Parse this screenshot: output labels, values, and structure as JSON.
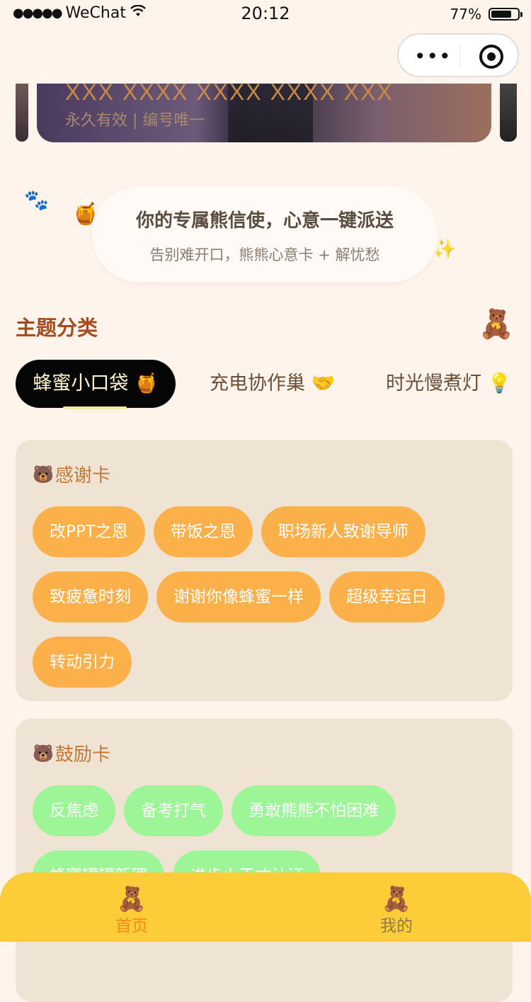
{
  "status_bar": {
    "signal": "●●●●●",
    "carrier": "WeChat",
    "wifi_icon": "wifi-icon",
    "time": "20:12",
    "battery_pct": "77%",
    "battery_level": 0.77
  },
  "capsule": {
    "more": "•••",
    "close_icon": "record-icon"
  },
  "banner": {
    "title": "XXX XXXX XXXX XXXX XXX",
    "subtitle": "永久有效 | 编号唯一"
  },
  "hero": {
    "title": "你的专属熊信使，心意一键派送",
    "subtitle": "告别难开口，熊熊心意卡 + 解忧愁",
    "paw": "🐾",
    "honey": "🍯",
    "sparkle": "✨"
  },
  "section": {
    "title": "主题分类",
    "mascot": "🧸"
  },
  "tabs": [
    {
      "label": "蜂蜜小口袋 🍯",
      "active": true
    },
    {
      "label": "充电协作巢 🤝",
      "active": false
    },
    {
      "label": "时光慢煮灯 💡",
      "active": false
    }
  ],
  "cards": [
    {
      "bear": "🐻",
      "title": "感谢卡",
      "chips": [
        "改PPT之恩",
        "带饭之恩",
        "职场新人致谢导师",
        "致疲惫时刻",
        "谢谢你像蜂蜜一样",
        "超级幸运日",
        "转动引力"
      ]
    },
    {
      "bear": "🐻",
      "title": "鼓励卡",
      "chips": [
        "反焦虑",
        "备考打气",
        "勇敢熊熊不怕困难",
        "蜂蜜罐罐新理",
        "进步小于才认证"
      ]
    }
  ],
  "nav": {
    "home": {
      "icon": "🧸",
      "label": "首页"
    },
    "mine": {
      "icon": "🧸",
      "label": "我的"
    }
  },
  "colors": {
    "accent_orange": "#fbb04a",
    "accent_green": "#9cf596",
    "nav_yellow": "#fdcc39",
    "section_title": "#a24d20"
  }
}
